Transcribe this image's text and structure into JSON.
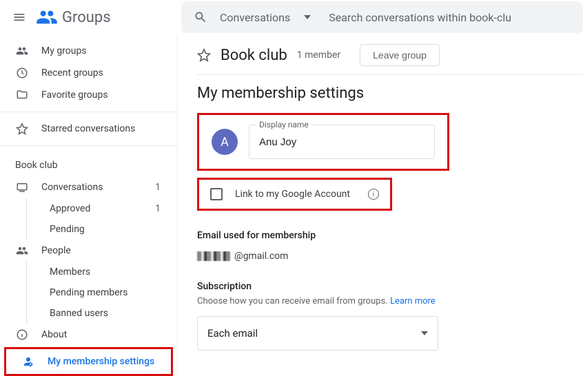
{
  "app": {
    "name": "Groups"
  },
  "search": {
    "scope": "Conversations",
    "placeholder": "Search conversations within book-clu"
  },
  "sidebar": {
    "top": {
      "my_groups": "My groups",
      "recent_groups": "Recent groups",
      "favorite_groups": "Favorite groups",
      "starred_conversations": "Starred conversations"
    },
    "group_heading": "Book club",
    "conversations": {
      "label": "Conversations",
      "count": "1",
      "approved": {
        "label": "Approved",
        "count": "1"
      },
      "pending": {
        "label": "Pending"
      }
    },
    "people": {
      "label": "People",
      "members": "Members",
      "pending_members": "Pending members",
      "banned_users": "Banned users"
    },
    "about": "About",
    "membership_settings": "My membership settings"
  },
  "group": {
    "name": "Book club",
    "member_count": "1 member",
    "leave_label": "Leave group"
  },
  "page": {
    "title": "My membership settings"
  },
  "display_name": {
    "label": "Display name",
    "value": "Anu Joy",
    "avatar_initial": "A"
  },
  "link_account": {
    "label": "Link to my Google Account"
  },
  "email_section": {
    "label": "Email used for membership",
    "suffix": "@gmail.com"
  },
  "subscription": {
    "label": "Subscription",
    "desc": "Choose how you can receive email from groups. ",
    "learn_more": "Learn more",
    "selected": "Each email"
  }
}
